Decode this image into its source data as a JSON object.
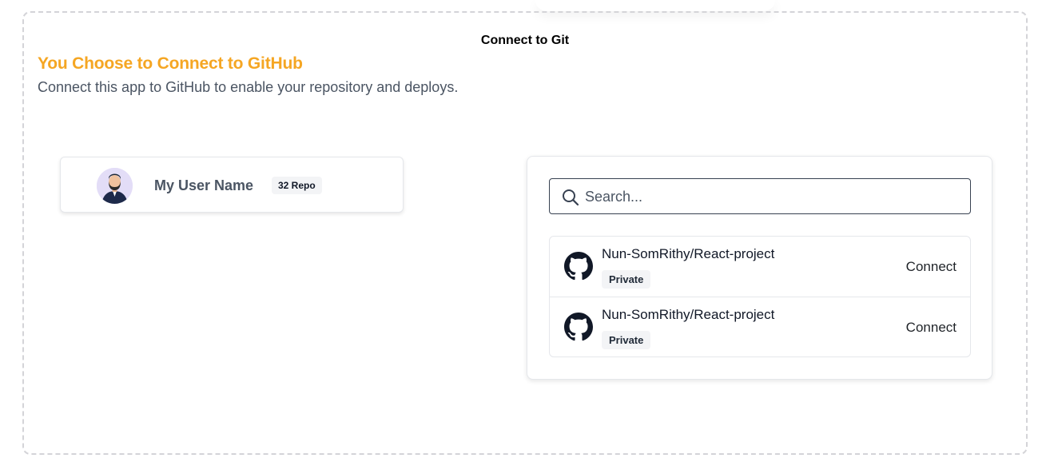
{
  "dialog": {
    "title": "Connect to Git",
    "heading": "You Choose to Connect to GitHub",
    "subheading": "Connect this app to GitHub to enable your repository and deploys."
  },
  "user": {
    "name": "My User Name",
    "repo_count": "32 Repo"
  },
  "search": {
    "placeholder": "Search..."
  },
  "repositories": [
    {
      "name": "Nun-SomRithy/React-project",
      "visibility": "Private",
      "action": "Connect"
    },
    {
      "name": "Nun-SomRithy/React-project",
      "visibility": "Private",
      "action": "Connect"
    }
  ],
  "colors": {
    "accent": "#f5a623",
    "border_dashed": "#d4d4d8",
    "badge_bg": "#f3f4f6"
  },
  "icons": {
    "avatar": "user-avatar-illustration",
    "search": "search-icon",
    "repo": "github-icon"
  }
}
